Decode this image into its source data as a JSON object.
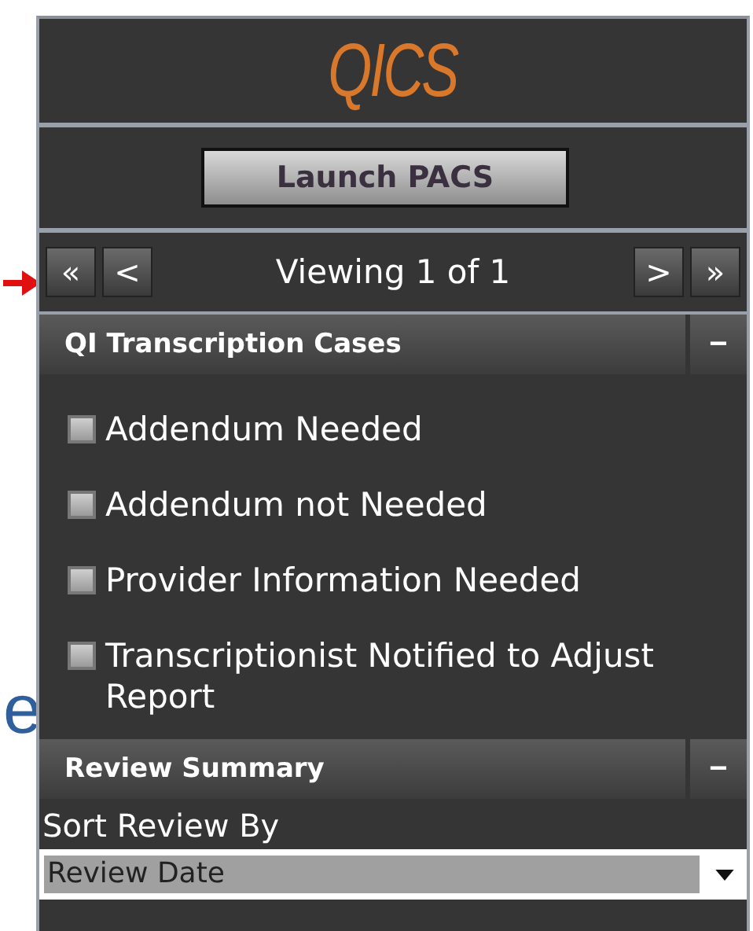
{
  "logo": "QICS",
  "launch_button": "Launch PACS",
  "pager": {
    "first": "«",
    "prev": "<",
    "status": "Viewing 1 of 1",
    "next": ">",
    "last": "»"
  },
  "sections": [
    {
      "title": "QI Transcription Cases",
      "collapse": "−",
      "expanded": true,
      "checkboxes": [
        {
          "label": "Addendum Needed",
          "checked": false
        },
        {
          "label": "Addendum not Needed",
          "checked": false
        },
        {
          "label": "Provider Information Needed",
          "checked": false
        },
        {
          "label": "Transcriptionist Notified to Adjust Report",
          "checked": false
        }
      ]
    },
    {
      "title": "Review Summary",
      "collapse": "−",
      "expanded": true,
      "sort_label": "Sort Review By",
      "sort_value": "Review Date"
    }
  ],
  "slide_fragment": "e"
}
